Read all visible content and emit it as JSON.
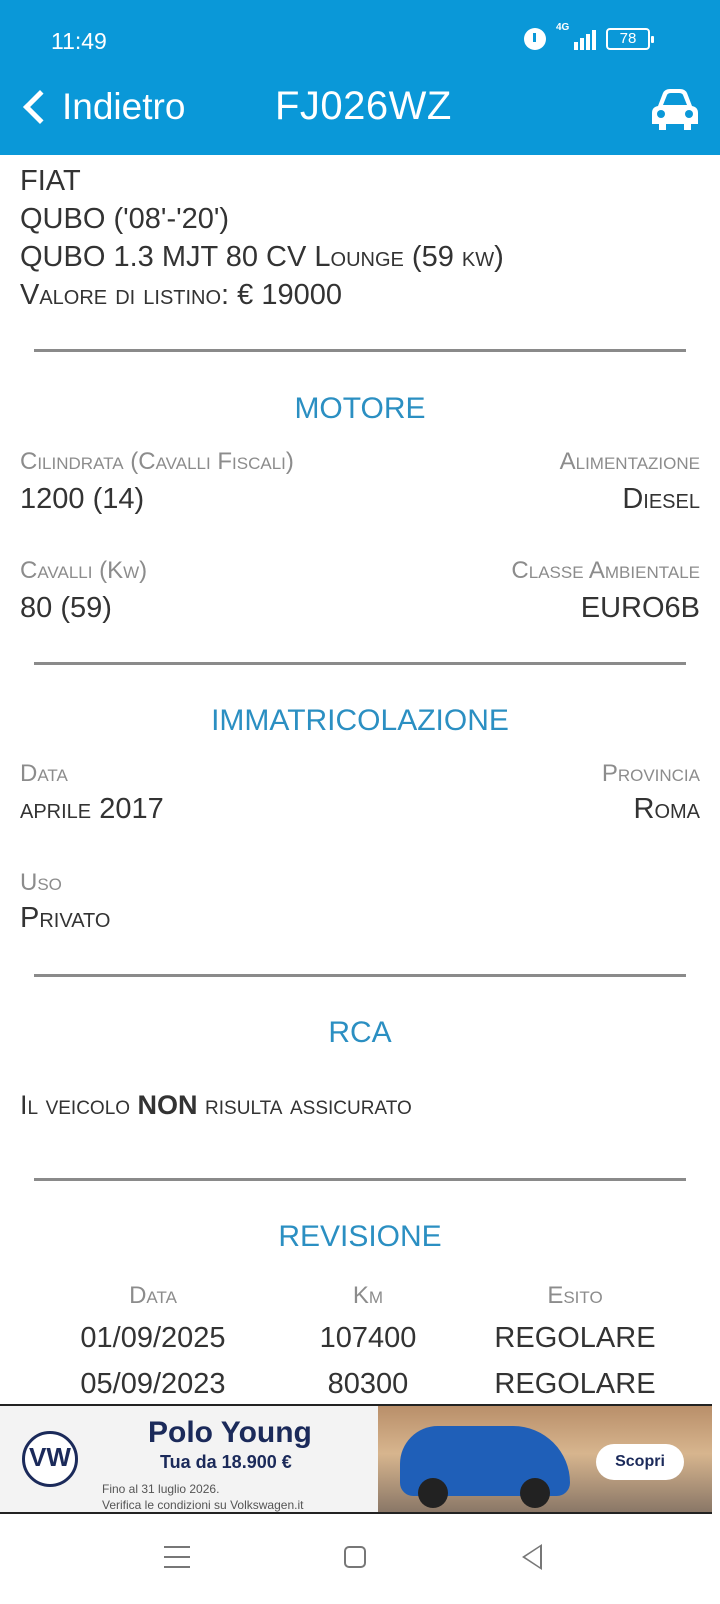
{
  "status_bar": {
    "time": "11:49",
    "network": "4G",
    "battery": "78"
  },
  "header": {
    "back_label": "Indietro",
    "plate": "FJ026WZ"
  },
  "vehicle": {
    "make": "FIAT",
    "model": "QUBO ('08'-'20')",
    "version": "QUBO 1.3 MJT 80 CV Lounge (59 kw)",
    "list_price": "Valore di listino: € 19000"
  },
  "motore": {
    "title": "MOTORE",
    "cilindrata_label": "Cilindrata (Cavalli Fiscali)",
    "cilindrata_value": "1200 (14)",
    "alimentazione_label": "Alimentazione",
    "alimentazione_value": "Diesel",
    "cavalli_label": "Cavalli (Kw)",
    "cavalli_value": "80 (59)",
    "classe_label": "Classe Ambientale",
    "classe_value": "EURO6B"
  },
  "immatricolazione": {
    "title": "IMMATRICOLAZIONE",
    "data_label": "Data",
    "data_value": "aprile 2017",
    "provincia_label": "Provincia",
    "provincia_value": "Roma",
    "uso_label": "Uso",
    "uso_value": "Privato"
  },
  "rca": {
    "title": "RCA",
    "text_before": "Il veicolo ",
    "text_bold": "NON",
    "text_after": " risulta assicurato"
  },
  "revisione": {
    "title": "REVISIONE",
    "columns": [
      "Data",
      "Km",
      "Esito"
    ],
    "rows": [
      {
        "data": "01/09/2025",
        "km": "107400",
        "esito": "REGOLARE"
      },
      {
        "data": "05/09/2023",
        "km": "80300",
        "esito": "REGOLARE"
      }
    ]
  },
  "ad": {
    "logo": "VW",
    "title": "Polo Young",
    "subtitle": "Tua da 18.900 €",
    "fine1": "Fino al 31 luglio 2026.",
    "fine2": "Verifica le condizioni su Volkswagen.it",
    "cta": "Scopri"
  },
  "colors": {
    "header": "#0a98d8",
    "section_title": "#2b8fc2"
  }
}
